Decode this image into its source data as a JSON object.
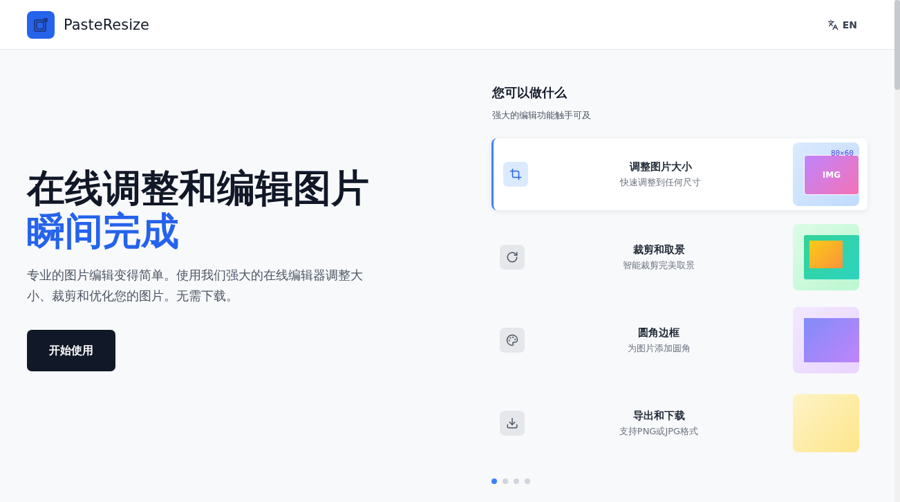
{
  "header": {
    "brand": "PasteResize",
    "language": "EN"
  },
  "hero": {
    "title_line1": "在线调整和编辑图片",
    "title_line2": "瞬间完成",
    "description": "专业的图片编辑变得简单。使用我们强大的在线编辑器调整大小、裁剪和优化您的图片。无需下载。",
    "cta": "开始使用"
  },
  "features": {
    "title": "您可以做什么",
    "subtitle": "强大的编辑功能触手可及",
    "items": [
      {
        "kind": "resize",
        "title": "调整图片大小",
        "description": "快速调整到任何尺寸",
        "selected": true,
        "preview_size": "80×60",
        "preview_label": "IMG"
      },
      {
        "kind": "crop",
        "title": "裁剪和取景",
        "description": "智能裁剪完美取景",
        "selected": false
      },
      {
        "kind": "rounded",
        "title": "圆角边框",
        "description": "为图片添加圆角",
        "selected": false
      },
      {
        "kind": "export",
        "title": "导出和下载",
        "description": "支持PNG或JPG格式",
        "selected": false
      }
    ],
    "dots": [
      {
        "selected": true
      },
      {
        "selected": false
      },
      {
        "selected": false
      },
      {
        "selected": false
      }
    ]
  }
}
